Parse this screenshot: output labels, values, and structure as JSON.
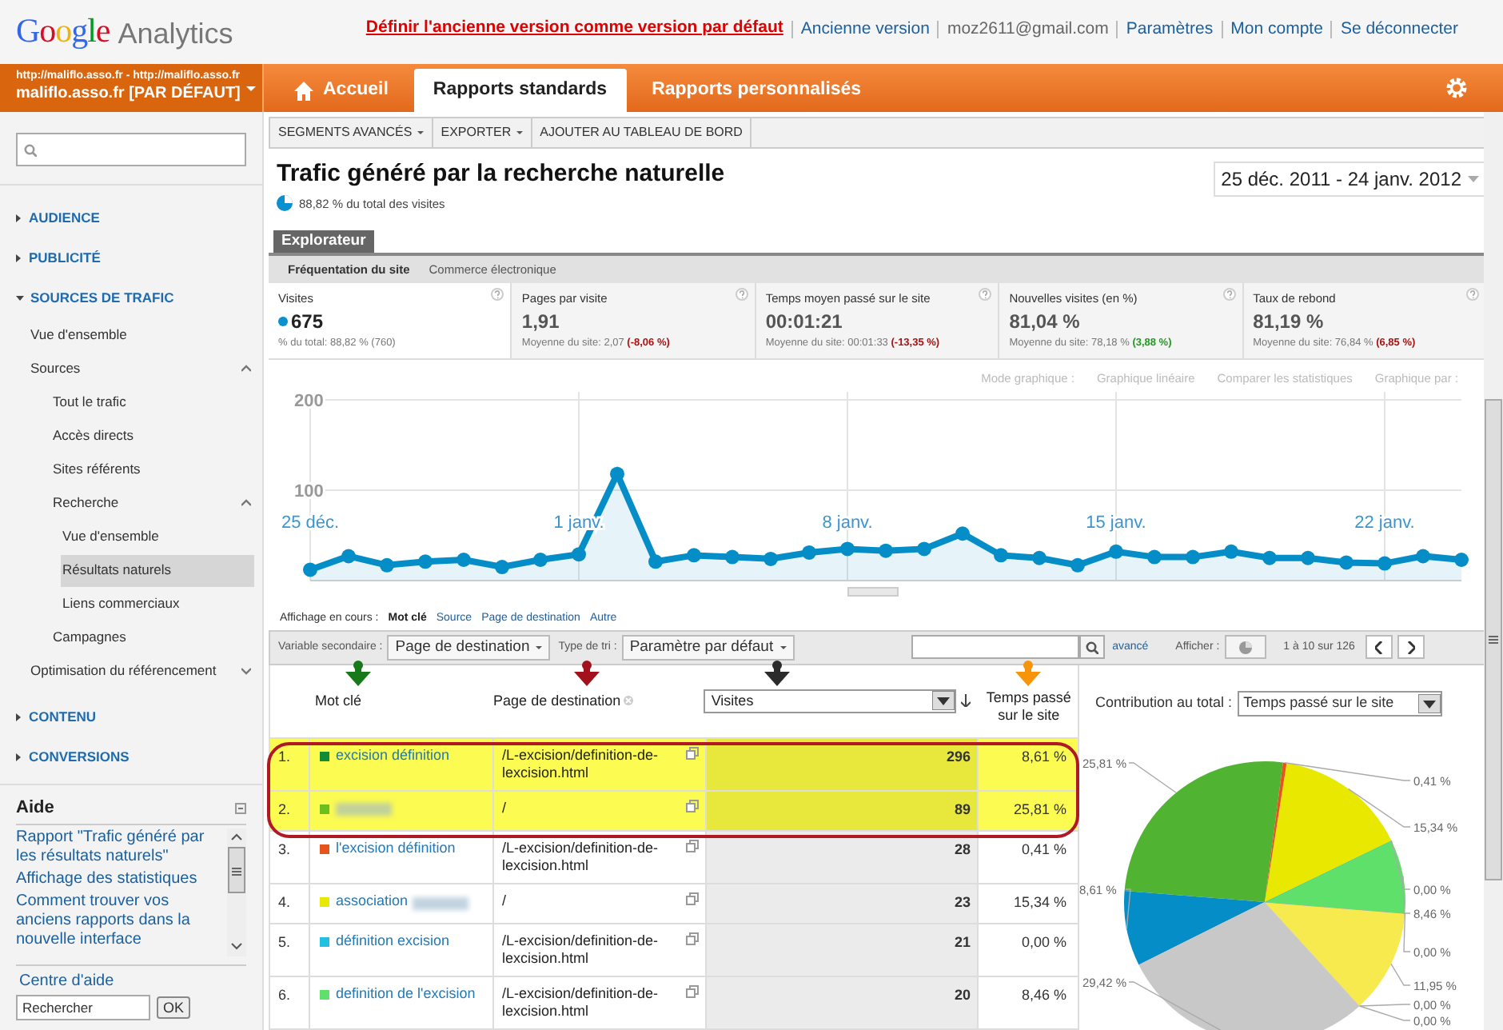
{
  "header": {
    "logo": [
      "Google",
      "Analytics"
    ],
    "links": [
      {
        "label": "Définir l'ancienne version comme version par défaut",
        "kind": "alert"
      },
      {
        "label": "Ancienne version",
        "kind": "link"
      },
      {
        "label": "moz2611@gmail.com",
        "kind": "text"
      },
      {
        "label": "Paramètres",
        "kind": "link"
      },
      {
        "label": "Mon compte",
        "kind": "link"
      },
      {
        "label": "Se déconnecter",
        "kind": "link"
      }
    ]
  },
  "account": {
    "urls": "http://maliflo.asso.fr - http://maliflo.asso.fr",
    "name": "maliflo.asso.fr [PAR DÉFAUT]"
  },
  "tabs": [
    {
      "label": "Accueil",
      "selected": false,
      "kind": "home"
    },
    {
      "label": "Rapports standards",
      "selected": true
    },
    {
      "label": "Rapports personnalisés",
      "selected": false
    }
  ],
  "toolbar": [
    "SEGMENTS AVANCÉS",
    "EXPORTER",
    "AJOUTER AU TABLEAU DE BORD"
  ],
  "sidebar": {
    "nav": [
      {
        "label": "AUDIENCE",
        "expanded": false,
        "selected": false
      },
      {
        "label": "PUBLICITÉ",
        "expanded": false,
        "selected": false
      },
      {
        "label": "SOURCES DE TRAFIC",
        "expanded": true,
        "selected": false,
        "children": [
          {
            "label": "Vue d'ensemble",
            "selected": false
          },
          {
            "label": "Sources",
            "expanded": true,
            "selected": false,
            "children": [
              {
                "label": "Tout le trafic",
                "selected": false
              },
              {
                "label": "Accès directs",
                "selected": false
              },
              {
                "label": "Sites référents",
                "selected": false
              },
              {
                "label": "Recherche",
                "expanded": true,
                "selected": false,
                "children": [
                  {
                    "label": "Vue d'ensemble",
                    "selected": false
                  },
                  {
                    "label": "Résultats naturels",
                    "selected": true
                  },
                  {
                    "label": "Liens commerciaux",
                    "selected": false
                  }
                ]
              },
              {
                "label": "Campagnes",
                "selected": false
              }
            ]
          },
          {
            "label": "Optimisation du référencement",
            "expanded": false,
            "selected": false
          }
        ]
      },
      {
        "label": "CONTENU",
        "expanded": false,
        "selected": false
      },
      {
        "label": "CONVERSIONS",
        "expanded": false,
        "selected": false
      }
    ],
    "help": {
      "title": "Aide",
      "links": [
        "Rapport \"Trafic généré par les résultats naturels\"",
        "Affichage des statistiques",
        "Comment trouver vos anciens rapports dans la nouvelle interface"
      ],
      "center": "Centre d'aide",
      "search_value": "Rechercher",
      "button": "OK"
    }
  },
  "report": {
    "title": "Trafic généré par la recherche naturelle",
    "subtitle": "88,82 % du total des visites",
    "date_range": "25 déc. 2011 - 24 janv. 2012",
    "explorer_tab": "Explorateur",
    "subtabs": [
      {
        "label": "Fréquentation du site",
        "selected": true
      },
      {
        "label": "Commerce électronique",
        "selected": false
      }
    ],
    "metrics": [
      {
        "label": "Visites",
        "value": "675",
        "note": "% du total: 88,82 % (760)",
        "selected": true
      },
      {
        "label": "Pages par visite",
        "value": "1,91",
        "note": "Moyenne du site: 2,07",
        "change": {
          "text": "(-8,06 %)",
          "color": "#aa1111"
        },
        "selected": false
      },
      {
        "label": "Temps moyen passé sur le site",
        "value": "00:01:21",
        "note": "Moyenne du site: 00:01:33",
        "change": {
          "text": "(-13,35 %)",
          "color": "#aa1111"
        },
        "selected": false
      },
      {
        "label": "Nouvelles visites (en %)",
        "value": "81,04 %",
        "note": "Moyenne du site: 78,18 %",
        "change": {
          "text": "(3,88 %)",
          "color": "#229922"
        },
        "selected": false
      },
      {
        "label": "Taux de rebond",
        "value": "81,19 %",
        "note": "Moyenne du site: 76,84 %",
        "change": {
          "text": "(6,85 %)",
          "color": "#aa1111"
        },
        "selected": false
      }
    ],
    "chart_options": [
      "Mode graphique :",
      "Graphique linéaire",
      "Comparer les statistiques",
      "Graphique par :"
    ],
    "chart": {
      "chart_data": {
        "type": "area",
        "x": [
          "25 déc.",
          null,
          null,
          null,
          null,
          null,
          null,
          "1 janv.",
          null,
          null,
          null,
          null,
          null,
          null,
          "8 janv.",
          null,
          null,
          null,
          null,
          null,
          null,
          "15 janv.",
          null,
          null,
          null,
          null,
          null,
          null,
          "22 janv.",
          null,
          null
        ],
        "series": [
          {
            "color": "#058dc7",
            "values": [
              12,
              27,
              17,
              21,
              23,
              15,
              23,
              29,
              118,
              21,
              28,
              26,
              24,
              31,
              35,
              33,
              35,
              52,
              28,
              25,
              17,
              32,
              26,
              26,
              32,
              25,
              25,
              20,
              19,
              27,
              23
            ]
          }
        ],
        "yticks": [
          100,
          200
        ],
        "ylim": [
          0,
          210
        ],
        "grid": true
      }
    },
    "views": {
      "label": "Affichage en cours :",
      "options": [
        {
          "label": "Mot clé",
          "selected": true
        },
        {
          "label": "Source",
          "selected": false
        },
        {
          "label": "Page de destination",
          "selected": false
        },
        {
          "label": "Autre",
          "selected": false
        }
      ]
    },
    "table_toolbar": {
      "secondary_label": "Variable secondaire :",
      "secondary_value": "Page de destination",
      "sort_label": "Type de tri :",
      "sort_value": "Paramètre par défaut",
      "advanced": "avancé",
      "show_label": "Afficher :",
      "pagination": "1 à 10 sur 126"
    },
    "columns": {
      "keyword": "Mot clé",
      "page": "Page de destination",
      "metric": "Visites",
      "time": "Temps passé sur le site",
      "contribution": "Contribution au total :",
      "contribution_value": "Temps passé sur le site"
    },
    "rows": [
      {
        "index": "1.",
        "color": "#138a36",
        "keyword": "excision définition",
        "page": "/L-excision/definition-de-lexcision.html",
        "visits": "296",
        "time": "8,61 %",
        "highlighted": true
      },
      {
        "index": "2.",
        "color": "#6cbf1f",
        "redacted": true,
        "page": "/",
        "visits": "89",
        "time": "25,81 %",
        "highlighted": true
      },
      {
        "index": "3.",
        "color": "#e5541b",
        "keyword": "l'excision définition",
        "page": "/L-excision/definition-de-lexcision.html",
        "visits": "28",
        "time": "0,41 %",
        "highlighted": false
      },
      {
        "index": "4.",
        "color": "#e8e800",
        "keyword": "association",
        "redacted": true,
        "page": "/",
        "visits": "23",
        "time": "15,34 %",
        "highlighted": false
      },
      {
        "index": "5.",
        "color": "#22c0e0",
        "keyword": "définition excision",
        "page": "/L-excision/definition-de-lexcision.html",
        "visits": "21",
        "time": "0,00 %",
        "highlighted": false
      },
      {
        "index": "6.",
        "color": "#5ee06a",
        "keyword": "definition de l'excision",
        "page": "/L-excision/definition-de-lexcision.html",
        "visits": "20",
        "time": "8,46 %",
        "highlighted": false
      }
    ],
    "pie": {
      "chart_data": {
        "type": "pie",
        "values": [
          0.41,
          15.34,
          0,
          8.46,
          0,
          11.95,
          0,
          0,
          29.42,
          8.61,
          25.81
        ],
        "value_labels": [
          "0,41 %",
          "15,34 %",
          "0,00 %",
          "8,46 %",
          "0,00 %",
          "11,95 %",
          "0,00 %",
          "0,00 %",
          "29,42 %",
          "8,61 %",
          "25,81 %"
        ],
        "colors": [
          "#e5541b",
          "#e8e800",
          "#22c0e0",
          "#5ee06a",
          "#aaaaaa",
          "#f7ea4f",
          "#cccccc",
          "#dddddd",
          "#c8c8c8",
          "#058dc7",
          "#50b432"
        ]
      }
    }
  },
  "annotations": {
    "arrows": [
      {
        "color": "#17791a"
      },
      {
        "color": "#a3111c"
      },
      {
        "color": "#2b2b2b"
      },
      {
        "color": "#f7940a"
      }
    ],
    "outline": {
      "color": "#b01824"
    }
  }
}
